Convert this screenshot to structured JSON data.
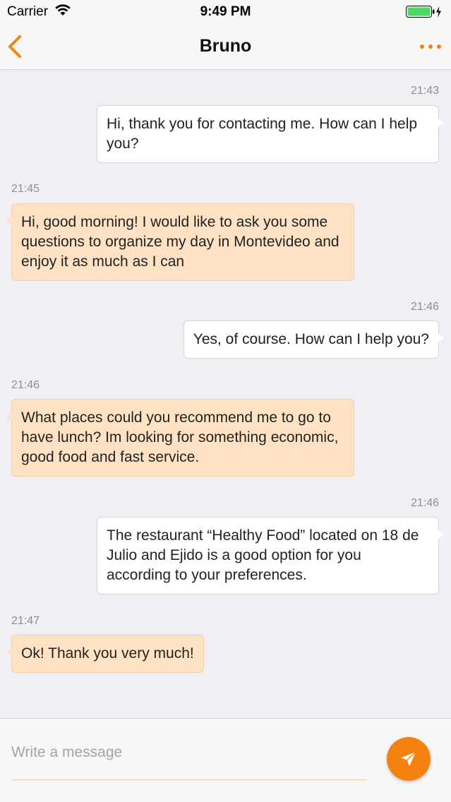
{
  "status_bar": {
    "carrier": "Carrier",
    "time": "9:49 PM",
    "battery_icon": "battery-charging-icon",
    "wifi_icon": "wifi-icon"
  },
  "nav": {
    "title": "Bruno",
    "back_icon": "chevron-left-icon",
    "more_icon": "more-dots-icon",
    "accent_color": "#f5820f"
  },
  "messages": [
    {
      "direction": "out",
      "time": "21:43",
      "text": "Hi, thank you for contacting me. How can I help you?"
    },
    {
      "direction": "in",
      "time": "21:45",
      "text": "Hi, good morning! I would like to ask you some questions to organize my day in Montevideo and enjoy it as much as I can"
    },
    {
      "direction": "out",
      "time": "21:46",
      "text": "Yes, of course. How can I help you?"
    },
    {
      "direction": "in",
      "time": "21:46",
      "text": "What places could you recommend me to go to have lunch? Im looking for something economic, good food and fast service."
    },
    {
      "direction": "out",
      "time": "21:46",
      "text": "The restaurant “Healthy Food” located on 18 de Julio and Ejido is a good option for you according to your preferences."
    },
    {
      "direction": "in",
      "time": "21:47",
      "text": "Ok! Thank you very much!"
    }
  ],
  "composer": {
    "placeholder": "Write a message",
    "value": "",
    "send_icon": "send-icon"
  },
  "colors": {
    "incoming_bubble": "#ffe2c4",
    "outgoing_bubble": "#ffffff",
    "accent": "#f5820f"
  }
}
